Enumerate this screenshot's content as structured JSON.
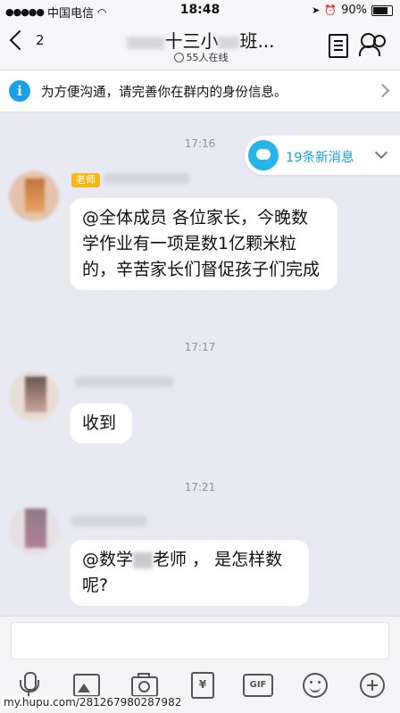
{
  "status_bar": {
    "signal": "●●●●●",
    "carrier": "中国电信",
    "wifi": "wifi-icon",
    "time": "18:48",
    "icons": [
      "location-arrow-icon",
      "alarm-icon"
    ],
    "battery_percent": "90%",
    "battery_level": 0.9
  },
  "nav": {
    "back_count": "2",
    "title_visible": "十三小",
    "title_suffix": "班...",
    "online_count": "55人在线"
  },
  "info_banner": {
    "icon": "i",
    "text": "为方便沟通，请完善你在群内的身份信息。"
  },
  "new_messages": {
    "label": "19条新消息"
  },
  "messages": [
    {
      "time": "17:16",
      "badge": "老师",
      "text": "@全体成员 各位家长，今晚数学作业有一项是数1亿颗米粒的，辛苦家长们督促孩子们完成"
    },
    {
      "time": "17:17",
      "text": "收到"
    },
    {
      "time": "17:21",
      "text_prefix": "@数学",
      "text_suffix": "老师 ， 是怎样数呢?"
    }
  ],
  "toolbar": {
    "red_packet_label": "¥",
    "gif_label": "GIF"
  },
  "watermark": "my.hupu.com/28126798028798​2"
}
